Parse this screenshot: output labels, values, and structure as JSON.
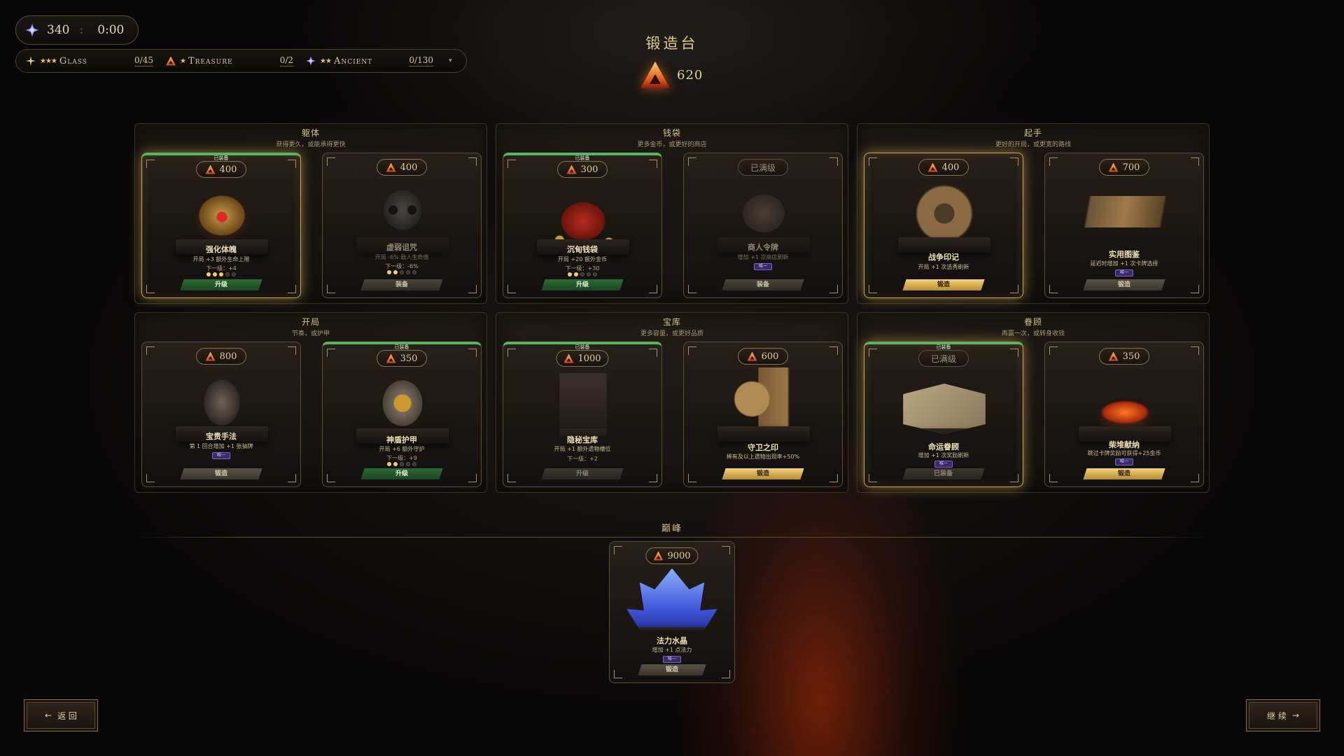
{
  "hud": {
    "souls": "340",
    "sep": ":",
    "timer": "0:00",
    "items": [
      {
        "stars": "★★★",
        "name": "Glass",
        "count": "0/45"
      },
      {
        "stars": "★",
        "name": "Treasure",
        "count": "0/2"
      },
      {
        "stars": "★★",
        "name": "Ancient",
        "count": "0/130"
      }
    ],
    "dropdown": "▾"
  },
  "title": "锻造台",
  "currency": "620",
  "sections": [
    {
      "title": "躯体",
      "subtitle": "获得更久，或能承得更快"
    },
    {
      "title": "钱袋",
      "subtitle": "更多金币，或更好的商店"
    },
    {
      "title": "起手",
      "subtitle": "更好的开局，或更宽的路线"
    },
    {
      "title": "开局",
      "subtitle": "节奏，或护甲"
    },
    {
      "title": "宝库",
      "subtitle": "更多容量，或更好品质"
    },
    {
      "title": "眷顾",
      "subtitle": "再赢一次，或转身收钱"
    }
  ],
  "cards": [
    {
      "cost": "400",
      "name": "强化体魄",
      "desc": "开局 +3 额外生命上限",
      "next": "下一级：+4",
      "button": "升级",
      "equipped_label": "已装备"
    },
    {
      "cost": "400",
      "name": "虚弱诅咒",
      "desc": "开局 -6% 敌人生命值",
      "next": "下一级：-6%",
      "button": "装备"
    },
    {
      "cost": "300",
      "name": "沉甸钱袋",
      "desc": "开局 +20 额外金币",
      "next": "下一级：+30",
      "button": "升级",
      "equipped_label": "已装备"
    },
    {
      "cost": "已满级",
      "name": "商人令牌",
      "desc": "增加 +1 次商店刷新",
      "tag": "唯一",
      "button": "装备"
    },
    {
      "cost": "400",
      "name": "战争印记",
      "desc": "开局 +1 次选秀刷新",
      "button": "锻造"
    },
    {
      "cost": "700",
      "name": "实用图鉴",
      "desc": "延迟时增加 +1 次卡牌选择",
      "tag": "唯一",
      "button": "锻造"
    },
    {
      "cost": "800",
      "name": "宝贵手法",
      "desc": "第 1 回合增加 +1 张抽牌",
      "tag": "唯一",
      "button": "锻造"
    },
    {
      "cost": "350",
      "name": "神盾护甲",
      "desc": "开局 +6 额外守护",
      "next": "下一级：+9",
      "button": "升级",
      "equipped_label": "已装备"
    },
    {
      "cost": "1000",
      "name": "隐秘宝库",
      "desc": "开局 +1 额外遗物槽位",
      "next": "下一级：+2",
      "button": "升级",
      "equipped_label": "已装备"
    },
    {
      "cost": "600",
      "name": "守卫之印",
      "desc": "稀有及以上遗物出现率+50%",
      "button": "锻造"
    },
    {
      "cost": "已满级",
      "name": "命运眷顾",
      "desc": "增加 +1 次奖励刷新",
      "tag": "唯一",
      "button": "已装备",
      "equipped_label": "已装备"
    },
    {
      "cost": "350",
      "name": "柴堆献纳",
      "desc": "跳过卡牌奖励可获得+25金币",
      "tag": "唯一",
      "button": "锻造"
    }
  ],
  "pinnacle": {
    "title": "巅峰",
    "card": {
      "cost": "9000",
      "name": "法力水晶",
      "desc": "增加 +1 点法力",
      "tag": "唯一",
      "button": "锻造"
    }
  },
  "nav": {
    "back": "返 回",
    "continue": "继 续"
  }
}
